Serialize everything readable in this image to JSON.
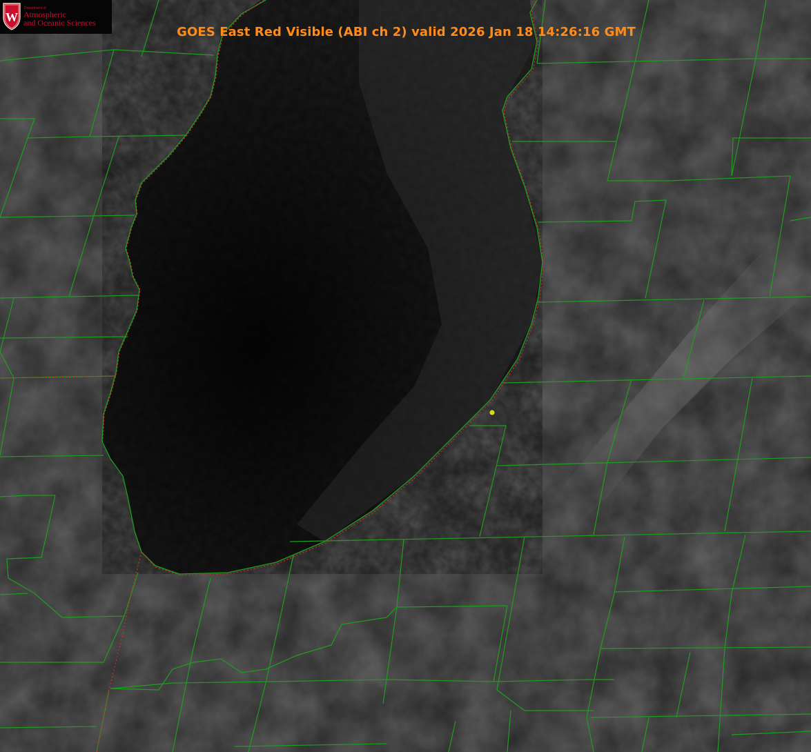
{
  "title": "GOES East Red Visible (ABI ch 2) valid 2026 Jan 18 14:26:16 GMT",
  "logo": {
    "department": "Department of",
    "line1": "Atmospheric",
    "line2": "and Oceanic Sciences",
    "crest_letter": "W"
  },
  "colors": {
    "title": "#ff8c1a",
    "county_lines": "#1f9e1f",
    "state_border": "#d42a2a",
    "marker": "#d8d820",
    "logo_red": "#c8102e"
  }
}
